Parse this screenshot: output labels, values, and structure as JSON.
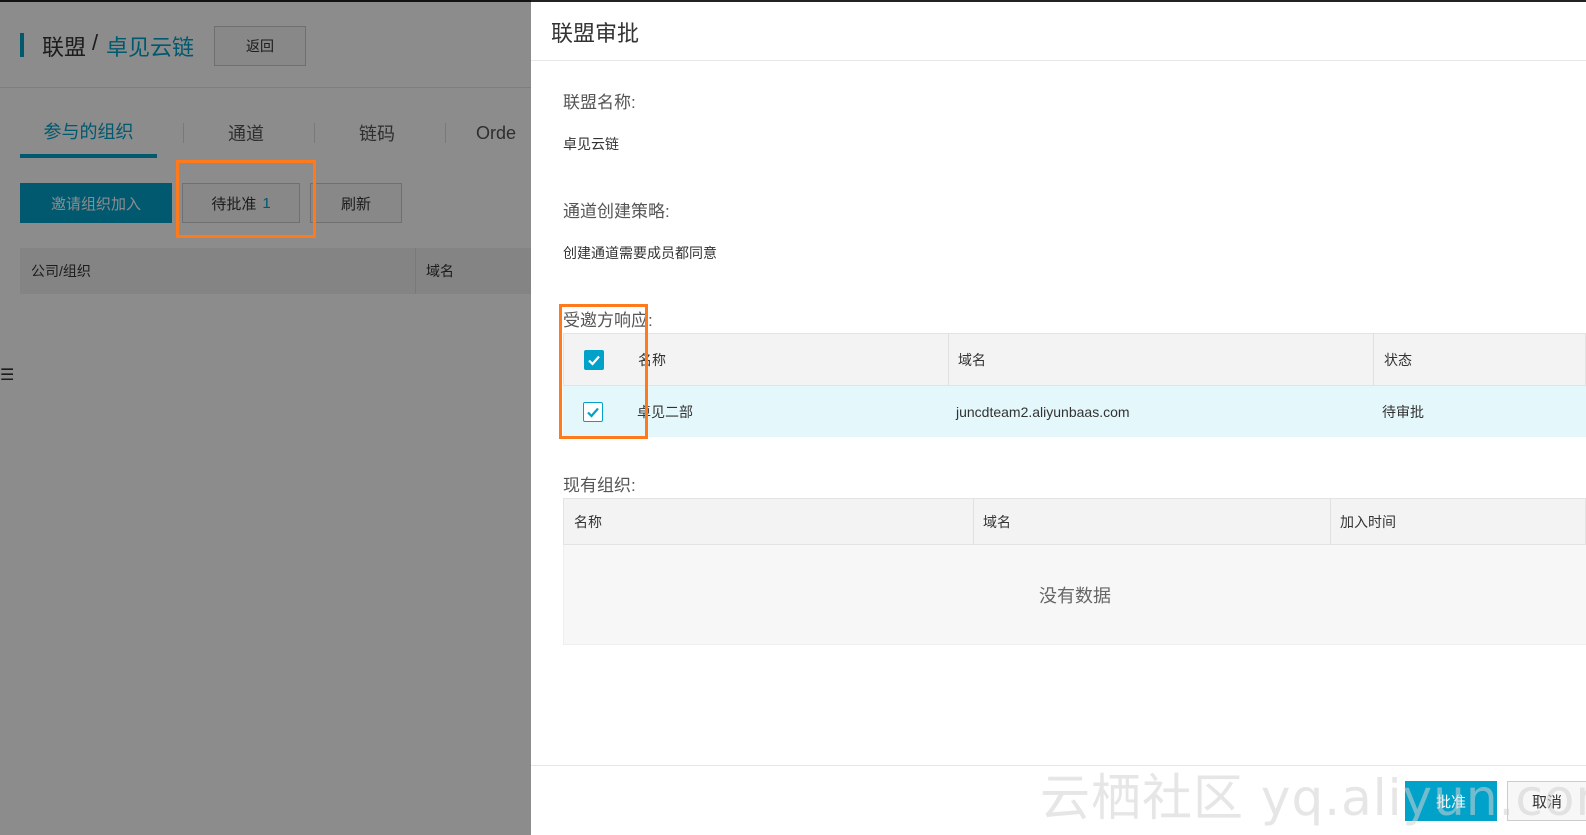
{
  "background": {
    "breadcrumb": {
      "root": "联盟",
      "separator": "/",
      "current": "卓见云链"
    },
    "back_label": "返回",
    "tabs": [
      {
        "label": "参与的组织",
        "active": true
      },
      {
        "label": "通道",
        "active": false
      },
      {
        "label": "链码",
        "active": false
      },
      {
        "label": "Orde",
        "active": false
      }
    ],
    "actions": {
      "invite_label": "邀请组织加入",
      "pending_label": "待批准",
      "pending_count": "1",
      "refresh_label": "刷新"
    },
    "table_headers": [
      "公司/组织",
      "域名"
    ]
  },
  "drawer": {
    "title": "联盟审批",
    "alliance_name_label": "联盟名称:",
    "alliance_name_value": "卓见云链",
    "policy_label": "通道创建策略:",
    "policy_value": "创建通道需要成员都同意",
    "invitee_label": "受邀方响应:",
    "invitee_table": {
      "headers": [
        "名称",
        "域名",
        "状态"
      ],
      "rows": [
        {
          "name": "卓见二部",
          "domain": "juncdteam2.aliyunbaas.com",
          "status": "待审批",
          "checked": true
        }
      ],
      "all_checked": true
    },
    "existing_label": "现有组织:",
    "existing_table": {
      "headers": [
        "名称",
        "域名",
        "加入时间"
      ],
      "empty_text": "没有数据"
    },
    "approve_label": "批准",
    "cancel_label": "取消"
  },
  "watermark": "云栖社区 yq.aliyun.com",
  "colors": {
    "accent": "#00a2ca",
    "annotation": "#ff7a1a",
    "row_highlight": "#e4f7fb"
  }
}
